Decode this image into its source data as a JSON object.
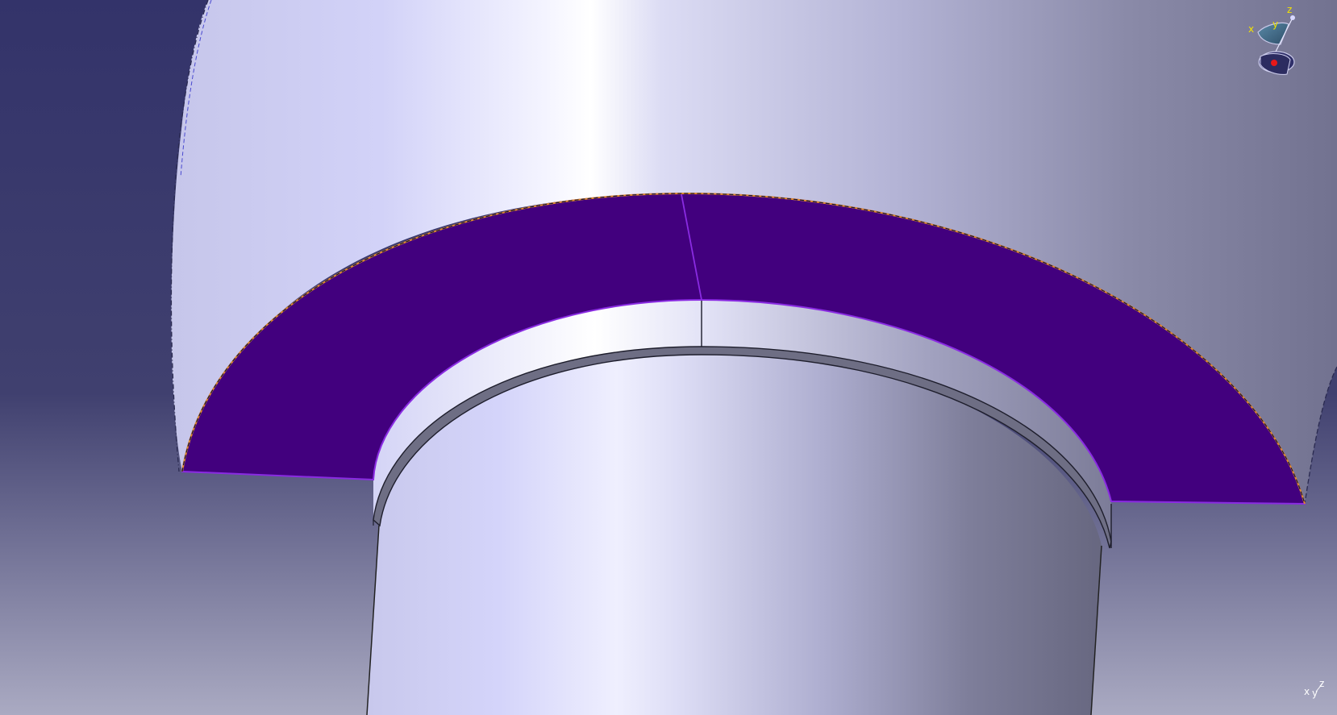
{
  "app": {
    "view": "3d-viewport"
  },
  "colors": {
    "background_top": "#34346a",
    "background_bottom": "#a9a9c1",
    "part_light": "#d0d0f8",
    "part_highlight": "#ffffff",
    "part_shadow": "#6c6c86",
    "selected_face": "#42007e",
    "selected_edge": "#8a2be2",
    "boundary_orange": "#e08a2a",
    "compass_letters": "#f2e300"
  },
  "compass": {
    "x_label": "x",
    "y_label": "y",
    "z_label": "z",
    "icon": "compass-icon"
  },
  "mini_axis": {
    "x_label": "x",
    "y_label": "y",
    "z_label": "z"
  }
}
